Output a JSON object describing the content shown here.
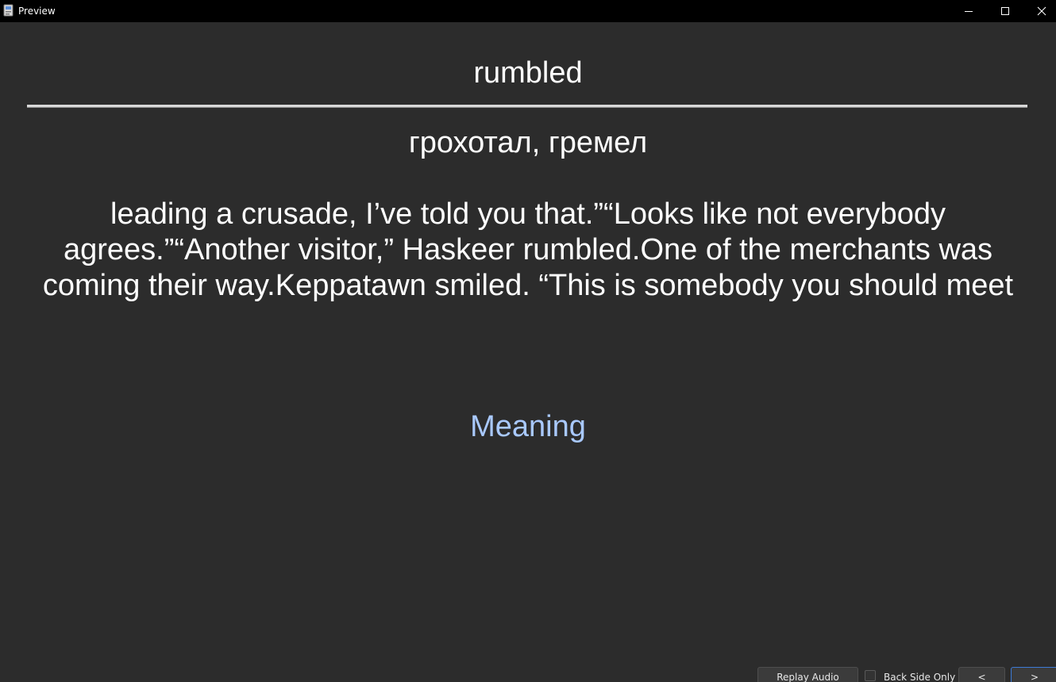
{
  "window": {
    "title": "Preview",
    "icon": "app-icon",
    "controls": {
      "minimize_icon": "minimize-icon",
      "maximize_icon": "maximize-icon",
      "close_icon": "close-icon"
    }
  },
  "card": {
    "front": "rumbled",
    "translation": "грохотал, гремел",
    "context": "leading a crusade, I’ve told you that.”“Looks like not everybody agrees.”“Another visitor,” Haskeer rumbled.One of the merchants was coming their way.Keppatawn smiled. “This is somebody you should meet",
    "meaning_label": "Meaning"
  },
  "controls": {
    "replay_audio": "Replay Audio",
    "back_side_only": "Back Side Only",
    "back_side_only_checked": false,
    "prev": "<",
    "next": ">"
  },
  "colors": {
    "background": "#2c2c2c",
    "titlebar": "#000000",
    "text": "#ffffff",
    "meaning": "#a9c9ff",
    "focus_border": "#3d7ad6"
  }
}
